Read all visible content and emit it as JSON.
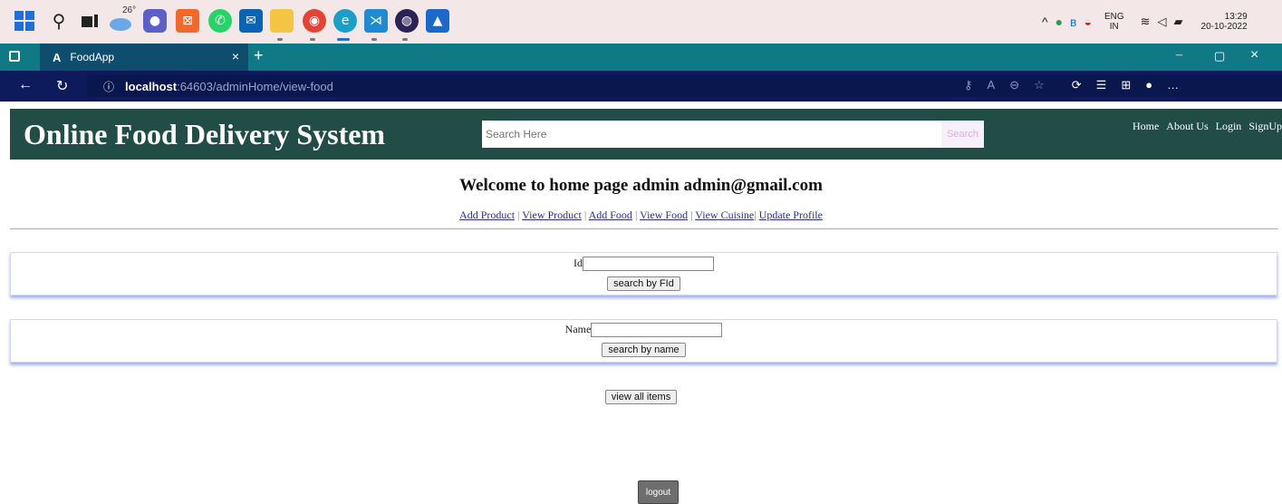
{
  "taskbar": {
    "weather_temp": "26°",
    "language": "ENG",
    "language_region": "IN",
    "time": "13:29",
    "date": "20-10-2022"
  },
  "browser": {
    "tab_title": "FoodApp",
    "tab_icon_letter": "A",
    "url_host": "localhost",
    "url_path": ":64603/adminHome/view-food"
  },
  "page": {
    "site_title": "Online Food Delivery System",
    "search": {
      "placeholder": "Search Here",
      "button_label": "Search"
    },
    "nav": [
      "Home",
      "About Us",
      "Login",
      "SignUp"
    ],
    "welcome": "Welcome to home page admin admin@gmail.com",
    "admin_links": [
      "Add Product",
      "View Product",
      "Add Food",
      "View Food",
      "View Cuisine",
      "Update Profile"
    ],
    "id_label": "Id",
    "id_value": "",
    "search_by_id_label": "search by FId",
    "name_label": "Name",
    "name_value": "",
    "search_by_name_label": "search by name",
    "view_all_label": "view all items",
    "logout_label": "logout"
  },
  "colors": {
    "header_bg": "#224d47",
    "tabstrip_bg": "#0f7a86",
    "addrbar_bg": "#0d1a5c",
    "link_color": "#2a2aa0"
  }
}
